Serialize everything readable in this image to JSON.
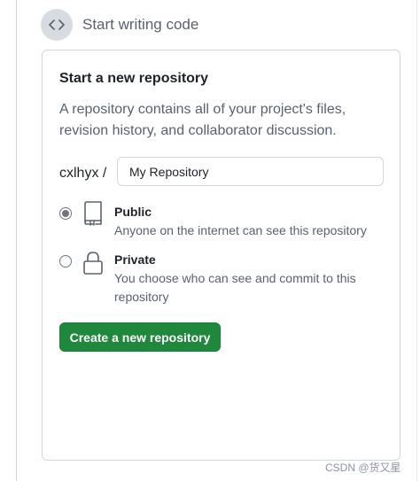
{
  "step": {
    "icon": "code-icon",
    "title": "Start writing code"
  },
  "card": {
    "title": "Start a new repository",
    "description": "A repository contains all of your project's files, revision history, and collaborator discussion."
  },
  "form": {
    "owner": "cxlhyx /",
    "repo_name": "My Repository"
  },
  "visibility": {
    "selected": "public",
    "options": [
      {
        "id": "public",
        "label": "Public",
        "description": "Anyone on the internet can see this repository",
        "icon": "repo-icon"
      },
      {
        "id": "private",
        "label": "Private",
        "description": "You choose who can see and commit to this repository",
        "icon": "lock-icon"
      }
    ]
  },
  "actions": {
    "create_label": "Create a new repository"
  },
  "watermark": "CSDN @货又星",
  "colors": {
    "primary_button": "#1f883d",
    "muted_text": "#59636e",
    "border": "#d0d7de"
  }
}
